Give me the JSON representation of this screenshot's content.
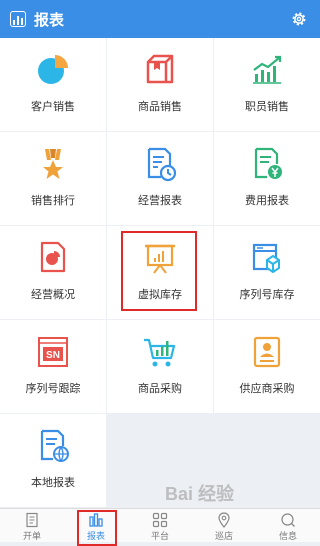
{
  "header": {
    "title": "报表",
    "settings_icon": "gear-icon",
    "logo_icon": "report-logo-icon"
  },
  "colors": {
    "brand": "#3a8ee6",
    "highlight": "#e02a2a"
  },
  "grid": {
    "items": [
      {
        "label": "客户销售",
        "icon": "pie-chart-icon"
      },
      {
        "label": "商品销售",
        "icon": "box-icon"
      },
      {
        "label": "职员销售",
        "icon": "trend-chart-icon"
      },
      {
        "label": "销售排行",
        "icon": "medal-icon"
      },
      {
        "label": "经营报表",
        "icon": "report-clock-icon"
      },
      {
        "label": "费用报表",
        "icon": "yen-report-icon"
      },
      {
        "label": "经营概况",
        "icon": "overview-doc-icon"
      },
      {
        "label": "虚拟库存",
        "icon": "presentation-board-icon"
      },
      {
        "label": "序列号库存",
        "icon": "serial-box-icon"
      },
      {
        "label": "序列号跟踪",
        "icon": "sn-tag-icon"
      },
      {
        "label": "商品采购",
        "icon": "shopping-cart-icon"
      },
      {
        "label": "供应商采购",
        "icon": "supplier-badge-icon"
      },
      {
        "label": "本地报表",
        "icon": "local-report-icon"
      }
    ]
  },
  "tabs": [
    {
      "label": "开单",
      "icon": "order-icon"
    },
    {
      "label": "报表",
      "icon": "bar-chart-icon",
      "active": true
    },
    {
      "label": "平台",
      "icon": "grid-icon"
    },
    {
      "label": "巡店",
      "icon": "location-icon"
    },
    {
      "label": "信息",
      "icon": "message-icon"
    }
  ],
  "watermark": "Bai 经验"
}
